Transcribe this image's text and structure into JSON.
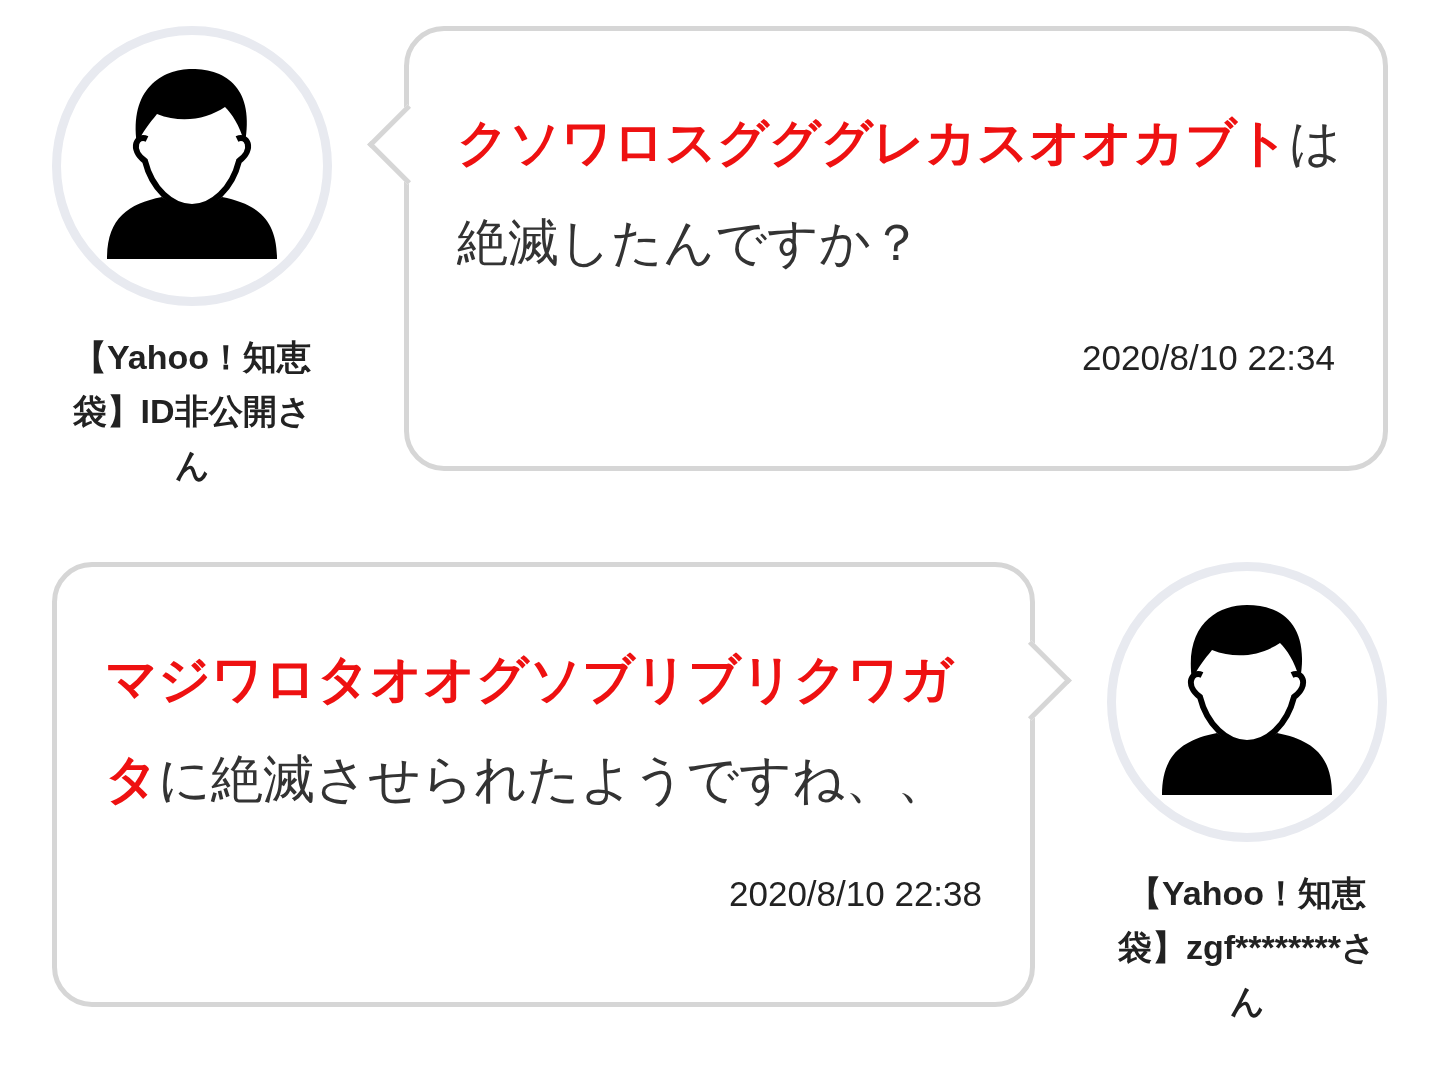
{
  "messages": [
    {
      "kind": "incoming",
      "user": "【Yahoo！知恵袋】ID非公開さん",
      "text_parts": [
        {
          "text": "クソワロスグググレカスオオカブト",
          "highlight": true
        },
        {
          "text": "は絶滅したんですか？",
          "highlight": false
        }
      ],
      "time": "2020/8/10 22:34"
    },
    {
      "kind": "outgoing",
      "user": "【Yahoo！知恵袋】zgf********さん",
      "text_parts": [
        {
          "text": "マジワロタオオグソブリブリクワガタ",
          "highlight": true
        },
        {
          "text": "に絶滅させられたようですね、、",
          "highlight": false
        }
      ],
      "time": "2020/8/10 22:38"
    }
  ]
}
